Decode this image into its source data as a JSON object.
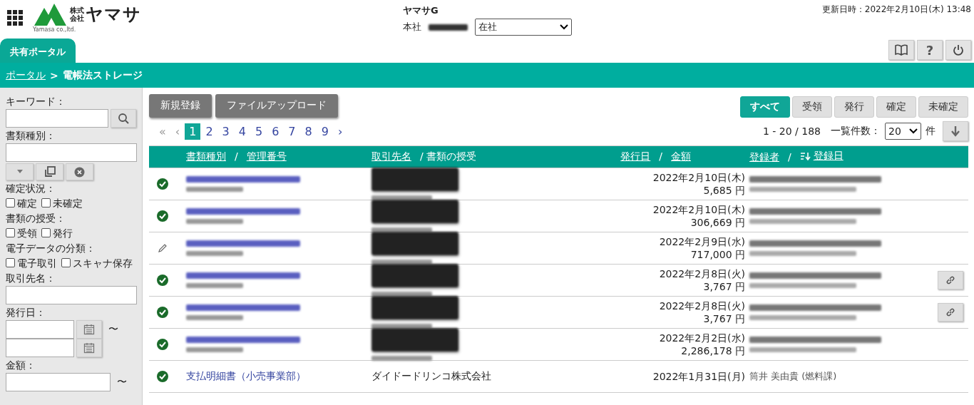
{
  "header": {
    "logo": {
      "small_top": "株式",
      "small_bottom": "会社",
      "name": "ヤマサ",
      "tagline": "Yamasa co.,ltd."
    },
    "user": {
      "group": "ヤマサG",
      "office": "本社",
      "presence": "在社"
    },
    "updated": "更新日時：2022年2月10日(木) 13:48"
  },
  "top_tabs": [
    {
      "label": "共有ポータル",
      "selected": true
    }
  ],
  "tool_buttons": [
    {
      "kind": "manual"
    },
    {
      "kind": "help",
      "label": "?"
    },
    {
      "kind": "power"
    }
  ],
  "breadcrumb": [
    {
      "label": "ポータル",
      "kind": "link"
    },
    {
      "label": ">",
      "kind": "sep"
    },
    {
      "label": "電帳法ストレージ",
      "kind": "current"
    }
  ],
  "sidebar": {
    "keyword_label": "キーワード：",
    "doctype_label": "書類種別：",
    "status_label": "確定状況：",
    "status_options": [
      {
        "label": "確定",
        "checked": false
      },
      {
        "label": "未確定",
        "checked": false
      }
    ],
    "exchange_label": "書類の授受：",
    "exchange_options": [
      {
        "label": "受領",
        "checked": false
      },
      {
        "label": "発行",
        "checked": false
      }
    ],
    "category_label": "電子データの分類：",
    "category_options": [
      {
        "label": "電子取引",
        "checked": false
      },
      {
        "label": "スキャナ保存",
        "checked": false
      }
    ],
    "partner_label": "取引先名：",
    "date_label": "発行日：",
    "tilde": "〜",
    "amount_label": "金額："
  },
  "actions": [
    "新規登録",
    "ファイルアップロード"
  ],
  "filters": [
    {
      "label": "すべて",
      "selected": true
    },
    {
      "label": "受領",
      "selected": false
    },
    {
      "label": "発行",
      "selected": false
    },
    {
      "label": "確定",
      "selected": false
    },
    {
      "label": "未確定",
      "selected": false
    }
  ],
  "pagination": {
    "first": "«",
    "prev": "‹",
    "next": "›",
    "pages": [
      {
        "label": "1",
        "selected": true
      },
      {
        "label": "2",
        "selected": false
      },
      {
        "label": "3",
        "selected": false
      },
      {
        "label": "4",
        "selected": false
      },
      {
        "label": "5",
        "selected": false
      },
      {
        "label": "6",
        "selected": false
      },
      {
        "label": "7",
        "selected": false
      },
      {
        "label": "8",
        "selected": false
      },
      {
        "label": "9",
        "selected": false
      }
    ]
  },
  "range": "1 - 20 / 188",
  "page_size_label": "一覧件数：",
  "page_size": "20",
  "page_size_unit": "件",
  "table": {
    "columns": [
      [
        {
          "text": "書類種別",
          "kind": "link"
        },
        {
          "text": "/",
          "kind": "plain"
        },
        {
          "text": "管理番号",
          "kind": "link"
        }
      ],
      [
        {
          "text": "取引先名",
          "kind": "link"
        },
        {
          "text": "/ 書類の授受",
          "kind": "plain"
        }
      ],
      [
        {
          "text": "発行日",
          "kind": "link"
        },
        {
          "text": "/",
          "kind": "plain"
        },
        {
          "text": "金額",
          "kind": "link"
        }
      ],
      [
        {
          "text": "登録者",
          "kind": "link"
        },
        {
          "text": "/",
          "kind": "plain"
        },
        {
          "text": "登録日",
          "kind": "sorted"
        }
      ]
    ],
    "rows": [
      {
        "kind": "confirmed",
        "date": "2022年2月10日(木)",
        "amount": "5,685 円",
        "link": false
      },
      {
        "kind": "confirmed",
        "date": "2022年2月10日(木)",
        "amount": "306,669 円",
        "link": false
      },
      {
        "kind": "draft",
        "date": "2022年2月9日(水)",
        "amount": "717,000 円",
        "link": false
      },
      {
        "kind": "confirmed",
        "date": "2022年2月8日(火)",
        "amount": "3,767 円",
        "link": true
      },
      {
        "kind": "confirmed",
        "date": "2022年2月8日(火)",
        "amount": "3,767 円",
        "link": true
      },
      {
        "kind": "confirmed",
        "date": "2022年2月2日(水)",
        "amount": "2,286,178 円",
        "link": false
      },
      {
        "kind": "confirmed",
        "doc": "支払明細書（小売事業部）",
        "partner": "ダイドードリンコ株式会社",
        "date": "2022年1月31日(月)",
        "registrant": "筒井 美由貴 (燃料課)",
        "link": false
      }
    ]
  }
}
